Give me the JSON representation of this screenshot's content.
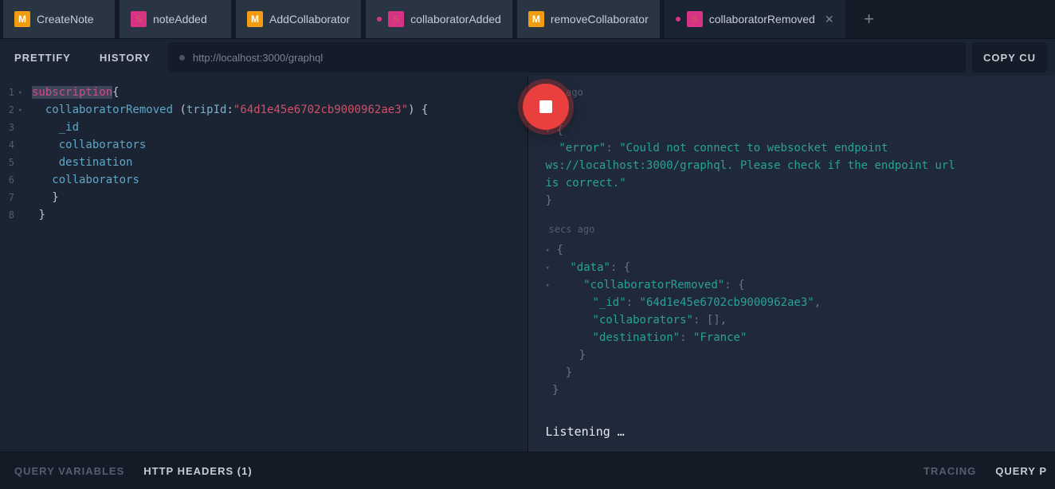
{
  "tabs": [
    {
      "badge": "M",
      "label": "CreateNote"
    },
    {
      "badge": "S",
      "label": "noteAdded"
    },
    {
      "badge": "M",
      "label": "AddCollaborator"
    },
    {
      "badge": "S",
      "label": "collaboratorAdded",
      "dot": true
    },
    {
      "badge": "M",
      "label": "removeCollaborator"
    },
    {
      "badge": "S",
      "label": "collaboratorRemoved",
      "dot": true,
      "active": true,
      "close": true
    }
  ],
  "toolbar": {
    "prettify": "Prettify",
    "history": "History",
    "url": "http://localhost:3000/graphql",
    "copy": "COPY CU"
  },
  "query": {
    "l1_kw": "subscription",
    "l2_fn": "collaboratorRemoved",
    "l2_arg": "tripId",
    "l2_val": "\"64d1e45e6702cb9000962ae3\"",
    "l3": "_id",
    "l4": "collaborators",
    "l5": "destination",
    "l6": "collaborators"
  },
  "resp": {
    "ago1": "in ago",
    "err_key": "\"error\"",
    "err_val": "\"Could not connect to websocket endpoint ws://localhost:3000/graphql. Please check if the endpoint url is correct.\"",
    "ago2": "secs ago",
    "data_key": "\"data\"",
    "cr_key": "\"collaboratorRemoved\"",
    "id_key": "\"_id\"",
    "id_val": "\"64d1e45e6702cb9000962ae3\"",
    "col_key": "\"collaborators\"",
    "col_val": "[]",
    "dest_key": "\"destination\"",
    "dest_val": "\"France\"",
    "listening": "Listening …"
  },
  "bottom": {
    "qv": "QUERY VARIABLES",
    "hh": "HTTP HEADERS (1)",
    "tr": "TRACING",
    "qp": "QUERY P"
  }
}
